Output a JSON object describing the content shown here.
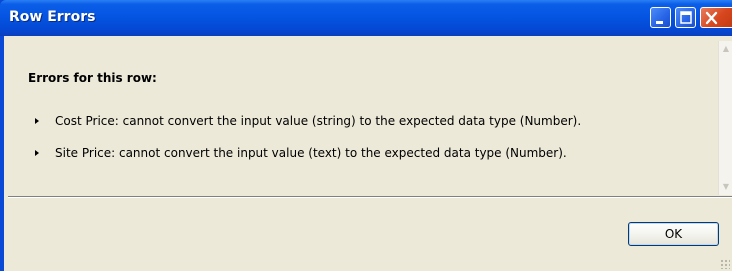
{
  "window": {
    "title": "Row Errors",
    "controls": {
      "minimize": "minimize-icon",
      "maximize": "maximize-icon",
      "close": "close-icon"
    }
  },
  "content": {
    "heading": "Errors for this row:",
    "errors": [
      "Cost Price: cannot convert the input value (string) to the expected data type (Number).",
      "Site Price: cannot convert the input value (text) to the expected data type (Number)."
    ]
  },
  "footer": {
    "ok_label": "OK"
  },
  "colors": {
    "titlebar": "#0555e2",
    "client": "#ece9d8",
    "close_button": "#d7471f"
  }
}
